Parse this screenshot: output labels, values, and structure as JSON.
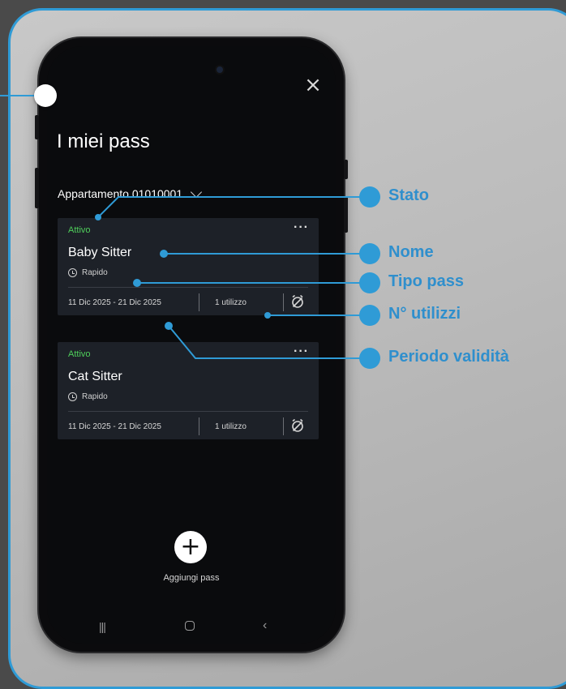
{
  "screen": {
    "title": "I miei pass",
    "apartment": "Appartamento 01010001",
    "add_label": "Aggiungi pass"
  },
  "passes": [
    {
      "status": "Attivo",
      "name": "Baby Sitter",
      "type": "Rapido",
      "period": "11 Dic 2025 - 21 Dic 2025",
      "uses": "1 utilizzo"
    },
    {
      "status": "Attivo",
      "name": "Cat Sitter",
      "type": "Rapido",
      "period": "11 Dic 2025 - 21 Dic 2025",
      "uses": "1 utilizzo"
    }
  ],
  "annotations": {
    "stato": "Stato",
    "nome": "Nome",
    "tipo_pass": "Tipo pass",
    "utilizzi": "N° utilizzi",
    "periodo": "Periodo validità"
  },
  "colors": {
    "accent": "#2f9bd6",
    "active_status": "#4fcf5b",
    "card_bg": "#1d2128"
  },
  "icons": {
    "close": "close-icon",
    "chevron": "chevron-down-icon",
    "more": "more-icon",
    "clock": "clock-icon",
    "no_alarm": "alarm-off-icon",
    "add": "plus-icon"
  }
}
